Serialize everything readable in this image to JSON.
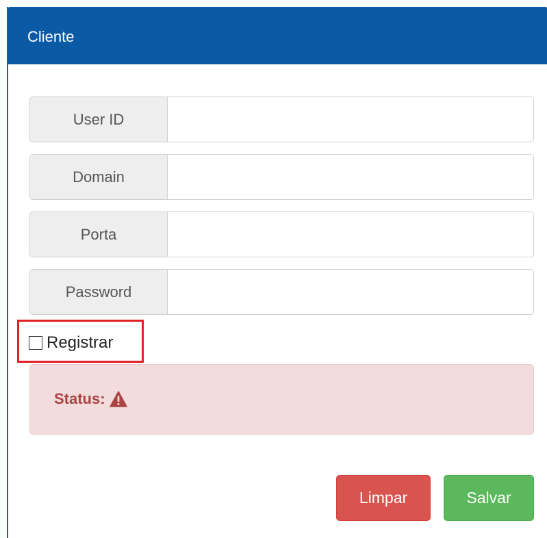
{
  "panel": {
    "title": "Cliente"
  },
  "form": {
    "fields": [
      {
        "label": "User ID",
        "value": ""
      },
      {
        "label": "Domain",
        "value": ""
      },
      {
        "label": "Porta",
        "value": ""
      },
      {
        "label": "Password",
        "value": ""
      }
    ],
    "register": {
      "label": "Registrar",
      "checked": false
    }
  },
  "status": {
    "label": "Status:",
    "icon": "warning-icon"
  },
  "buttons": {
    "clear_label": "Limpar",
    "save_label": "Salvar"
  },
  "colors": {
    "header": "#0a5aa6",
    "danger": "#d9534f",
    "success": "#5cb85c",
    "alert_bg": "#f2dcdd",
    "alert_text": "#a94442",
    "highlight": "#e31e26"
  }
}
